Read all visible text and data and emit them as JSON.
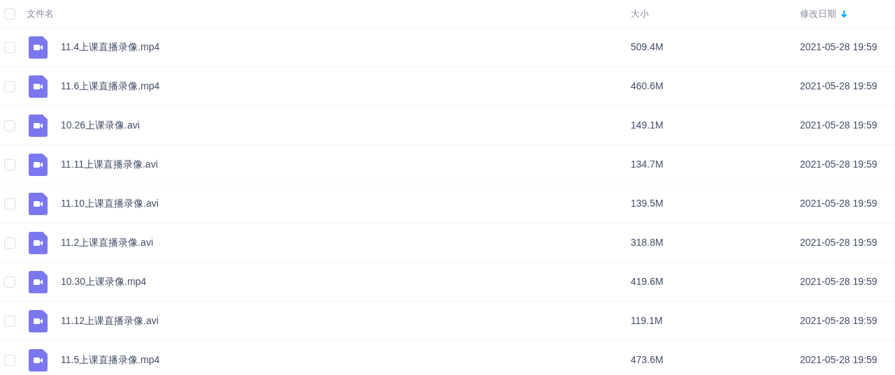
{
  "header": {
    "checked": false,
    "columns": [
      {
        "label": "文件名",
        "sorted": false
      },
      {
        "label": "大小",
        "sorted": false
      },
      {
        "label": "修改日期",
        "sorted": true
      }
    ]
  },
  "rows": [
    {
      "checked": false,
      "name": "11.4上课直播录像.mp4",
      "size": "509.4M",
      "modified": "2021-05-28 19:59"
    },
    {
      "checked": false,
      "name": "11.6上课直播录像.mp4",
      "size": "460.6M",
      "modified": "2021-05-28 19:59"
    },
    {
      "checked": false,
      "name": "10.26上课录像.avi",
      "size": "149.1M",
      "modified": "2021-05-28 19:59"
    },
    {
      "checked": false,
      "name": "11.11上课直播录像.avi",
      "size": "134.7M",
      "modified": "2021-05-28 19:59"
    },
    {
      "checked": false,
      "name": "11.10上课直播录像.avi",
      "size": "139.5M",
      "modified": "2021-05-28 19:59"
    },
    {
      "checked": false,
      "name": "11.2上课直播录像.avi",
      "size": "318.8M",
      "modified": "2021-05-28 19:59"
    },
    {
      "checked": false,
      "name": "10.30上课录像.mp4",
      "size": "419.6M",
      "modified": "2021-05-28 19:59"
    },
    {
      "checked": false,
      "name": "11.12上课直播录像.avi",
      "size": "119.1M",
      "modified": "2021-05-28 19:59"
    },
    {
      "checked": false,
      "name": "11.5上课直播录像.mp4",
      "size": "473.6M",
      "modified": "2021-05-28 19:59"
    }
  ]
}
